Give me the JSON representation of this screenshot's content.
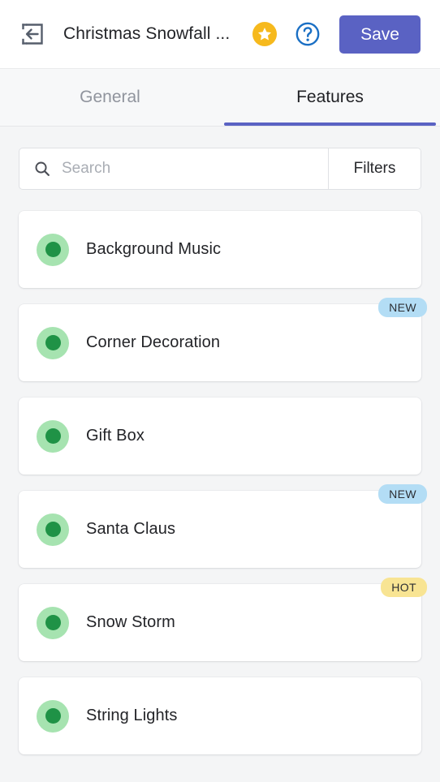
{
  "header": {
    "back_icon": "back-arrow-in-box-icon",
    "title": "Christmas Snowfall ...",
    "star_icon": "star-icon",
    "help_icon": "help-question-icon",
    "save_label": "Save",
    "save_color": "#5a62c3",
    "star_color": "#f6b91d",
    "help_color": "#1a6fc4"
  },
  "tabs": {
    "items": [
      {
        "label": "General",
        "active": false
      },
      {
        "label": "Features",
        "active": true
      }
    ],
    "active_indicator_color": "#5a62c3"
  },
  "search": {
    "icon": "search-icon",
    "value": "",
    "placeholder": "Search",
    "filters_label": "Filters"
  },
  "features": {
    "status_on_color": "#1f9246",
    "status_halo_color": "#a6e3b0",
    "badge_new_color": "#b3ddf5",
    "badge_hot_color": "#f8e493",
    "items": [
      {
        "label": "Background Music",
        "status": "on",
        "badge": ""
      },
      {
        "label": "Corner Decoration",
        "status": "on",
        "badge": "NEW"
      },
      {
        "label": "Gift Box",
        "status": "on",
        "badge": ""
      },
      {
        "label": "Santa Claus",
        "status": "on",
        "badge": "NEW"
      },
      {
        "label": "Snow Storm",
        "status": "on",
        "badge": "HOT"
      },
      {
        "label": "String Lights",
        "status": "on",
        "badge": ""
      }
    ]
  }
}
